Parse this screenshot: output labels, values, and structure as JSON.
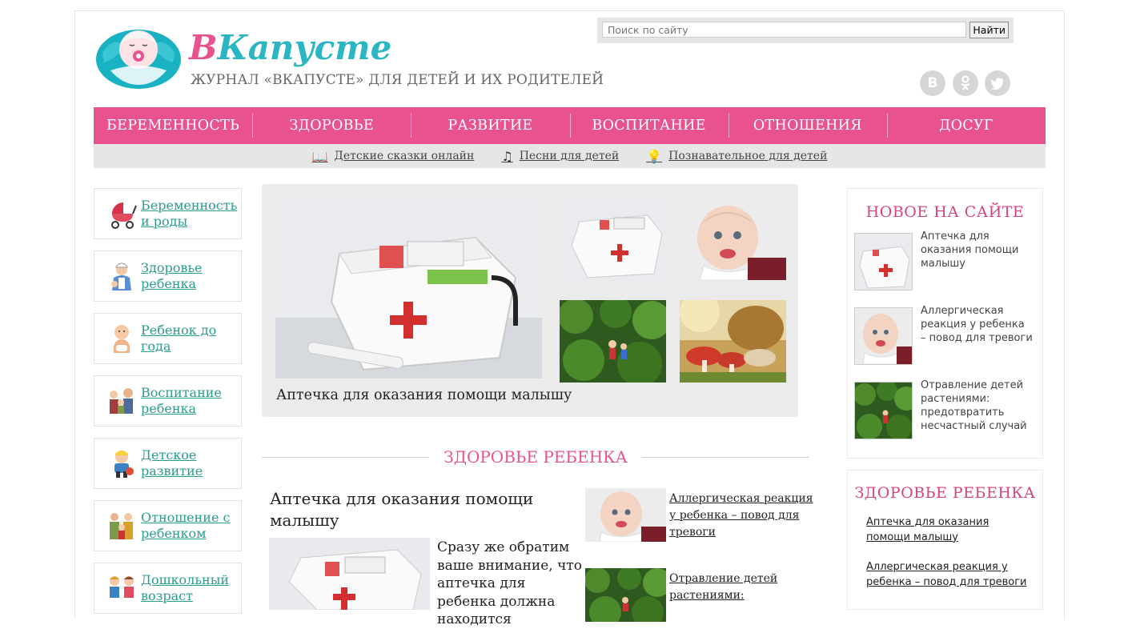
{
  "site": {
    "brand_part1": "В",
    "brand_part2": "Капусте",
    "tagline": "ЖУРНАЛ «ВКАПУСТЕ» ДЛЯ ДЕТЕЙ И ИХ РОДИТЕЛЕЙ",
    "accent_color": "#e8528f",
    "teal_color": "#2bb6c4"
  },
  "search": {
    "placeholder": "Поиск по сайту",
    "button_label": "Найти"
  },
  "social": [
    {
      "icon": "vk-icon",
      "glyph": "В"
    },
    {
      "icon": "odnoklassniki-icon",
      "glyph": "ок"
    },
    {
      "icon": "twitter-icon",
      "glyph": "t"
    }
  ],
  "nav": {
    "items": [
      "БЕРЕМЕННОСТЬ",
      "ЗДОРОВЬЕ",
      "РАЗВИТИЕ",
      "ВОСПИТАНИЕ",
      "ОТНОШЕНИЯ",
      "ДОСУГ"
    ]
  },
  "subnav": {
    "items": [
      {
        "icon": "book-icon",
        "label": "Детские сказки онлайн"
      },
      {
        "icon": "music-note-icon",
        "label": "Песни для детей"
      },
      {
        "icon": "lightbulb-icon",
        "label": "Познавательное для детей"
      }
    ]
  },
  "sidebar": {
    "categories": [
      {
        "icon": "stroller-icon",
        "line1": "Беременность",
        "line2": "и роды"
      },
      {
        "icon": "doctor-icon",
        "line1": "Здоровье",
        "line2": "ребенка"
      },
      {
        "icon": "baby-icon",
        "line1": "Ребенок до",
        "line2": "года"
      },
      {
        "icon": "family-icon",
        "line1": "Воспитание",
        "line2": "ребенка"
      },
      {
        "icon": "child-play-icon",
        "line1": "Детское",
        "line2": "развитие"
      },
      {
        "icon": "parents-icon",
        "line1": "Отношение с",
        "line2": "ребенком"
      },
      {
        "icon": "schoolkids-icon",
        "line1": "Дошкольный",
        "line2": "возраст"
      }
    ]
  },
  "featured": {
    "caption": "Аптечка для оказания помощи малышу"
  },
  "health_section": {
    "title": "ЗДОРОВЬЕ РЕБЕНКА",
    "main_article": {
      "title": "Аптечка для оказания помощи малышу",
      "excerpt": "Сразу же обратим ваше внимание, что аптечка для ребенка должна находится"
    },
    "side_articles": [
      {
        "title": "Аллергическая реакция у ребенка – повод для тревоги"
      },
      {
        "title": "Отравление детей растениями:"
      }
    ]
  },
  "new_on_site": {
    "title": "НОВОЕ НА САЙТЕ",
    "items": [
      {
        "title": "Аптечка для оказания помощи малышу"
      },
      {
        "title": "Аллергическая реакция у ребенка – повод для тревоги"
      },
      {
        "title": "Отравление детей растениями: предотвратить несчастный случай"
      }
    ]
  },
  "health_box": {
    "title": "ЗДОРОВЬЕ РЕБЕНКА",
    "links": [
      "Аптечка для оказания помощи малышу",
      "Аллергическая реакция у ребенка – повод для тревоги"
    ]
  }
}
